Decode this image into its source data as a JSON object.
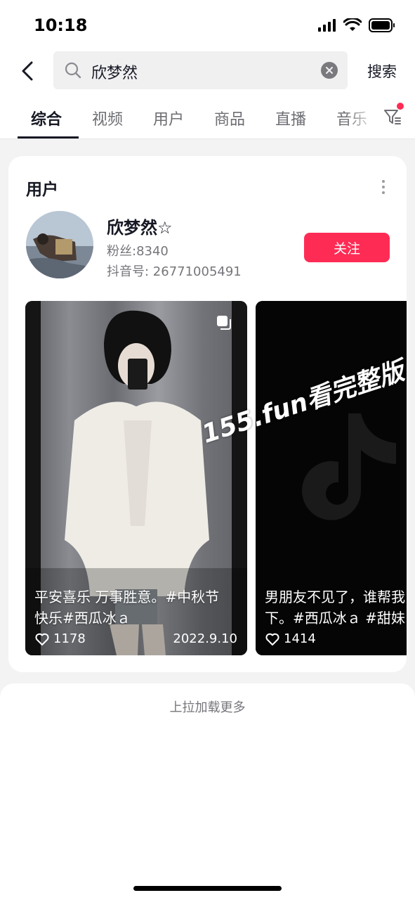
{
  "status_bar": {
    "time": "10:18"
  },
  "search": {
    "query": "欣梦然",
    "button": "搜索"
  },
  "tabs": [
    {
      "label": "综合",
      "active": true
    },
    {
      "label": "视频"
    },
    {
      "label": "用户"
    },
    {
      "label": "商品"
    },
    {
      "label": "直播"
    },
    {
      "label": "音乐"
    }
  ],
  "user_section": {
    "title": "用户",
    "name": "欣梦然☆",
    "fans": "粉丝:8340",
    "douyin_id": "抖音号: 26771005491",
    "follow_label": "关注"
  },
  "videos": [
    {
      "caption": "平安喜乐 万事胜意。#中秋节\n快乐#西瓜冰ａ",
      "likes": "1178",
      "date": "2022.9.10"
    },
    {
      "caption": "男朋友不见了，谁帮我\n下。#西瓜冰ａ #甜妹",
      "likes": "1414"
    }
  ],
  "watermark": "155.fun看完整版",
  "load_more": "上拉加载更多",
  "colors": {
    "accent": "#fe2c55",
    "text": "#161823",
    "secondary": "#75767b"
  }
}
